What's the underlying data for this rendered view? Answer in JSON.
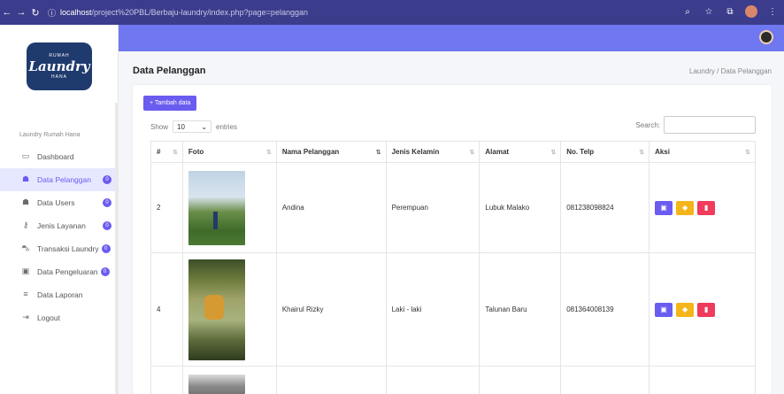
{
  "browser": {
    "url_host": "localhost",
    "url_path": "/project%20PBL/Berbaju-laundry/index.php?page=pelanggan"
  },
  "sidebar": {
    "logo_top": "RUMAH",
    "logo_main": "Laundry",
    "logo_sub": "HANA",
    "brand": "Laundry Rumah Hana",
    "items": [
      {
        "label": "Dashboard",
        "icon": "monitor-icon",
        "badge": ""
      },
      {
        "label": "Data Pelanggan",
        "icon": "users-icon",
        "badge": "0",
        "active": true
      },
      {
        "label": "Data Users",
        "icon": "users-group-icon",
        "badge": "0"
      },
      {
        "label": "Jenis Layanan",
        "icon": "key-icon",
        "badge": "0"
      },
      {
        "label": "Transaksi Laundry",
        "icon": "cart-icon",
        "badge": "0"
      },
      {
        "label": "Data Pengeluaran",
        "icon": "wallet-icon",
        "badge": "0"
      },
      {
        "label": "Data Laporan",
        "icon": "list-icon",
        "badge": ""
      },
      {
        "label": "Logout",
        "icon": "logout-icon",
        "badge": ""
      }
    ]
  },
  "header": {
    "title": "Data Pelanggan",
    "breadcrumb": "Laundry / Data Pelanggan"
  },
  "card": {
    "add_button": "+ Tambah data",
    "show_label": "Show",
    "entries_value": "10",
    "entries_label": "entries",
    "search_label": "Search:",
    "search_value": ""
  },
  "table": {
    "headers": [
      "#",
      "Foto",
      "Nama Pelanggan",
      "Jenis Kelamin",
      "Alamat",
      "No. Telp",
      "Aksi"
    ],
    "rows": [
      {
        "no": "2",
        "nama": "Andina",
        "jk": "Perempuan",
        "alamat": "Lubuk Malako",
        "telp": "081238098824"
      },
      {
        "no": "4",
        "nama": "Khairul Rizky",
        "jk": "Laki - laki",
        "alamat": "Talunan Baru",
        "telp": "081364008139"
      }
    ]
  },
  "colors": {
    "accent": "#6b5cf0",
    "topbar": "#6f78f0",
    "edit": "#f5b51a",
    "delete": "#ef3b5c"
  }
}
